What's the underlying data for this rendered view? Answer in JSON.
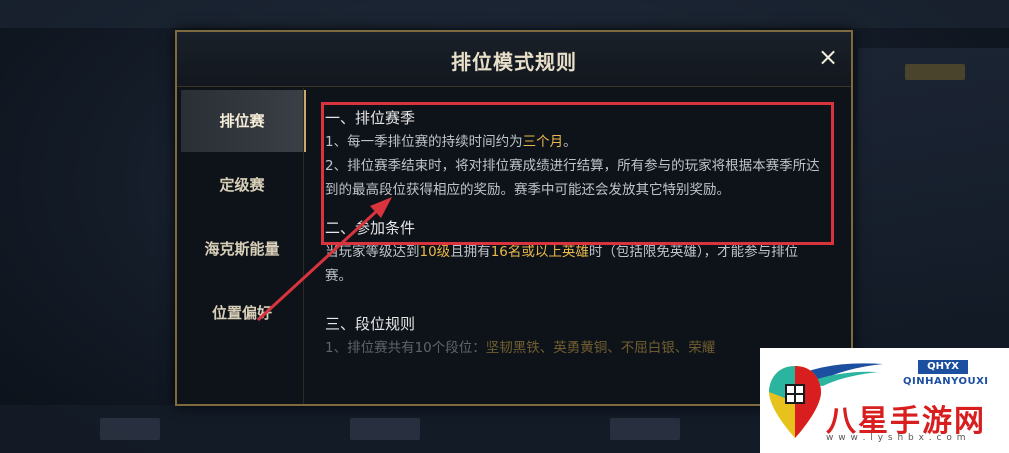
{
  "modal": {
    "title": "排位模式规则",
    "close_label": "×"
  },
  "sidebar": {
    "items": [
      {
        "label": "排位赛",
        "active": true
      },
      {
        "label": "定级赛",
        "active": false
      },
      {
        "label": "海克斯能量",
        "active": false
      },
      {
        "label": "位置偏好",
        "active": false
      }
    ]
  },
  "content": {
    "section1": {
      "heading": "一、排位赛季",
      "line1_pre": "1、每一季排位赛的持续时间约为",
      "line1_highlight": "三个月",
      "line1_post": "。",
      "line2": "2、排位赛季结束时，将对排位赛成绩进行结算，所有参与的玩家将根据本赛季所达到的最高段位获得相应的奖励。赛季中可能还会发放其它特别奖励。"
    },
    "section2": {
      "heading": "二、参加条件",
      "text_pre": "当玩家等级达到",
      "level": "10级",
      "text_mid": "且拥有",
      "heroes": "16名或以上英雄",
      "text_post": "时（包括限免英雄），才能参与排位赛。"
    },
    "section3": {
      "heading": "三、段位规则",
      "line1_pre": "1、排位赛共有10个段位：",
      "tiers": "坚韧黑铁、英勇黄铜、不屈白银、荣耀"
    }
  },
  "watermark": {
    "badge": "QHYX",
    "english": "QINHANYOUXI",
    "chinese": "八星手游网",
    "url": "w w w . l y s h b x . c o m"
  },
  "colors": {
    "accent_gold": "#c9a86a",
    "highlight": "#e8b84a",
    "annotation_red": "#d9343d",
    "watermark_red": "#d81e1e",
    "watermark_blue": "#1c4fa0"
  }
}
